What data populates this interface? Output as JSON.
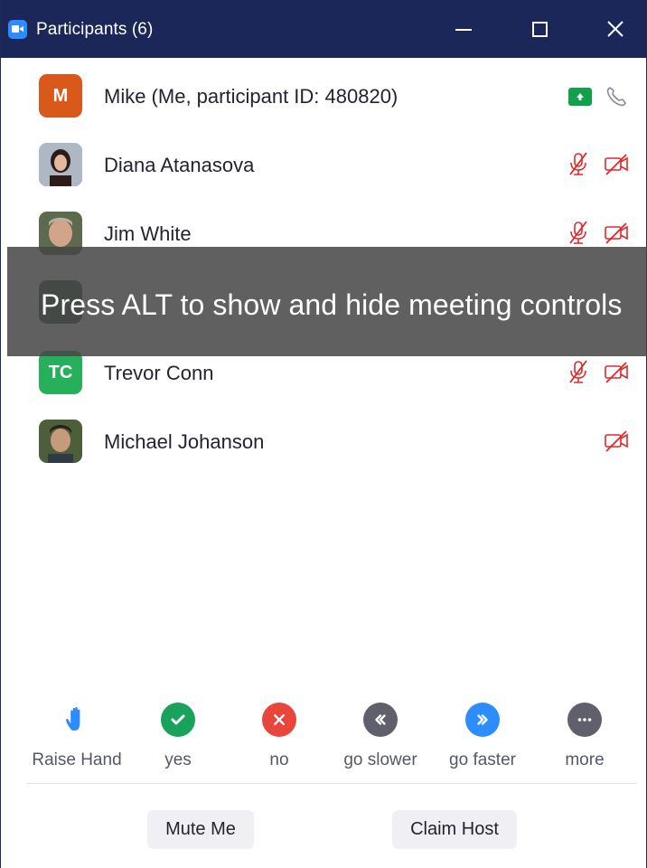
{
  "window": {
    "title": "Participants (6)"
  },
  "colors": {
    "titlebar": "#1b2659",
    "muted_red": "#e02828",
    "share_green": "#12a14b",
    "accent_blue": "#2d8cff"
  },
  "participants": [
    {
      "name": "Mike (Me, participant ID: 480820)",
      "initials": "M",
      "avatar_color": "#d9591a",
      "audio": "phone",
      "video": "sharing"
    },
    {
      "name": "Diana Atanasova",
      "initials": "",
      "avatar_color": "#6d6a79",
      "audio": "muted",
      "video": "off"
    },
    {
      "name": "Jim White",
      "initials": "",
      "avatar_color": "#7a6a5a",
      "audio": "muted",
      "video": "off"
    },
    {
      "name": "",
      "initials": "",
      "avatar_color": "#3a5a4a",
      "audio": "hidden",
      "video": "hidden"
    },
    {
      "name": "Trevor Conn",
      "initials": "TC",
      "avatar_color": "#27b05b",
      "audio": "muted",
      "video": "off"
    },
    {
      "name": "Michael Johanson",
      "initials": "",
      "avatar_color": "#4a5a3a",
      "audio": "none",
      "video": "off"
    }
  ],
  "overlay": {
    "message": "Press ALT to show and hide meeting controls"
  },
  "reactions": [
    {
      "label": "Raise Hand",
      "icon": "raise-hand-icon"
    },
    {
      "label": "yes",
      "icon": "check-icon"
    },
    {
      "label": "no",
      "icon": "x-icon"
    },
    {
      "label": "go slower",
      "icon": "rewind-icon"
    },
    {
      "label": "go faster",
      "icon": "fast-forward-icon"
    },
    {
      "label": "more",
      "icon": "more-dots-icon"
    }
  ],
  "buttons": {
    "mute": "Mute Me",
    "claim_host": "Claim Host"
  }
}
